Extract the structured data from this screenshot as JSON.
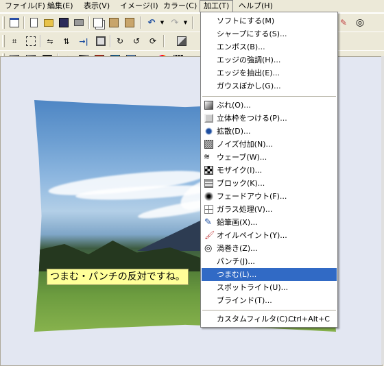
{
  "menubar": {
    "file": "ファイル(F)",
    "edit": "編集(E)",
    "view": "表示(V)",
    "image": "イメージ(I)",
    "color": "カラー(C)",
    "process": "加工(T)",
    "help": "ヘルプ(H)"
  },
  "process_menu": {
    "soft": "ソフトにする(M)",
    "sharp": "シャープにする(S)...",
    "emboss": "エンボス(B)...",
    "edge_enhance": "エッジの強調(H)...",
    "edge_extract": "エッジを抽出(E)...",
    "gauss": "ガウスぼかし(G)...",
    "blur": "ぶれ(O)...",
    "frame3d": "立体枠をつける(P)...",
    "diffuse": "拡散(D)...",
    "noise": "ノイズ付加(N)...",
    "wave": "ウェーブ(W)...",
    "mosaic": "モザイク(I)...",
    "block": "ブロック(K)...",
    "fadeout": "フェードアウト(F)...",
    "glass": "ガラス処理(V)...",
    "pencil": "鉛筆画(X)...",
    "oilpaint": "オイルペイント(Y)...",
    "swirl": "渦巻き(Z)...",
    "punch": "パンチ(J)...",
    "pinch": "つまむ(L)...",
    "spotlight": "スポットライト(U)...",
    "blind": "ブラインド(T)...",
    "custom": "カスタムフィルタ(C)...",
    "custom_shortcut": "Ctrl+Alt+C"
  },
  "canvas": {
    "caption": "つまむ・パンチの反対ですね。"
  },
  "colors": {
    "highlight": "#316ac5",
    "caption_bg": "#ffff99",
    "workarea_bg": "#e3e7f2"
  }
}
